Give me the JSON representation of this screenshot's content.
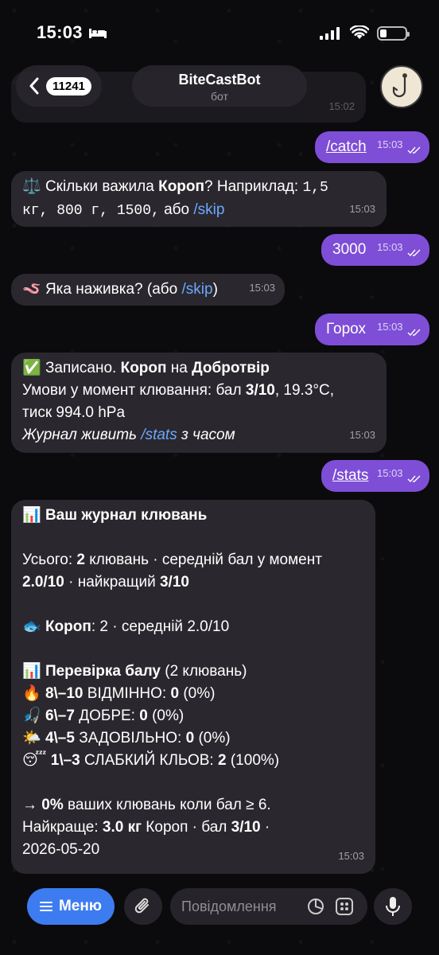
{
  "status": {
    "time": "15:03"
  },
  "header": {
    "back_count": "11241",
    "bot_name": "BiteCastBot",
    "bot_sub": "бот"
  },
  "prev_msg": {
    "time": "15:02"
  },
  "messages": {
    "m1": {
      "text": "/catch",
      "time": "15:03"
    },
    "m2": {
      "emoji": "⚖️",
      "t1": "Скільки важила ",
      "b1": "Короп",
      "t2": "? Наприклад: ",
      "mono1": "1,5",
      "mono2": "кг, 800 г, 1500,",
      "t3": " або ",
      "link": "/skip",
      "time": "15:03"
    },
    "m3": {
      "text": "3000",
      "time": "15:03"
    },
    "m4": {
      "emoji": "🪱",
      "t1": "Яка наживка? (або ",
      "link": "/skip",
      "t2": ")",
      "time": "15:03"
    },
    "m5": {
      "text": "Горох",
      "time": "15:03"
    },
    "m6": {
      "emoji": "✅",
      "t1": "Записано. ",
      "b1": "Короп",
      "t2": " на ",
      "b2": "Добротвір",
      "line2a": "Умови у момент клювання: бал ",
      "line2b": "3/10",
      "line2c": ", 19.3°C,",
      "line3": "тиск 994.0 hPa",
      "line4a": "Журнал живить ",
      "line4link": "/stats",
      "line4b": " з часом",
      "time": "15:03"
    },
    "m7": {
      "text": "/stats",
      "time": "15:03"
    },
    "m8": {
      "head_emoji": "📊",
      "head": "Ваш журнал клювань",
      "tot1": "Усього: ",
      "tot_b": "2",
      "tot2": " клювань · середній бал у момент",
      "tot_avg": "2.0/10",
      "tot3": " · найкращий ",
      "tot_best": "3/10",
      "fish_emoji": "🐟",
      "fish_b": "Короп",
      "fish_t": ": 2 · середній 2.0/10",
      "check_emoji": "📊",
      "check_b": "Перевірка балу",
      "check_t": " (2 клювань)",
      "r1_emoji": "🔥",
      "r1_b": "8\\–10",
      "r1_t": " ВІДМІННО: ",
      "r1_v": "0",
      "r1_p": " (0%)",
      "r2_emoji": "🎣",
      "r2_b": "6\\–7",
      "r2_t": " ДОБРЕ: ",
      "r2_v": "0",
      "r2_p": " (0%)",
      "r3_emoji": "🌤️",
      "r3_b": "4\\–5",
      "r3_t": " ЗАДОВІЛЬНО: ",
      "r3_v": "0",
      "r3_p": " (0%)",
      "r4_emoji": "😴",
      "r4_b": "1\\–3",
      "r4_t": " СЛАБКИЙ КЛЬОВ: ",
      "r4_v": "2",
      "r4_p": " (100%)",
      "arrow": "→ ",
      "pct_b": "0%",
      "pct_t": " ваших клювань коли бал ≥ 6.",
      "best1": "Найкраще: ",
      "best_b": "3.0 кг",
      "best2": " Короп · бал ",
      "best_b2": "3/10",
      "best3": " ·",
      "date": "2026-05-20",
      "time": "15:03"
    }
  },
  "bottom": {
    "menu_label": "Меню",
    "placeholder": "Повідомлення"
  },
  "colors": {
    "accent": "#7e4ed6",
    "menu": "#3d7cf0",
    "link": "#6ca8ff"
  }
}
